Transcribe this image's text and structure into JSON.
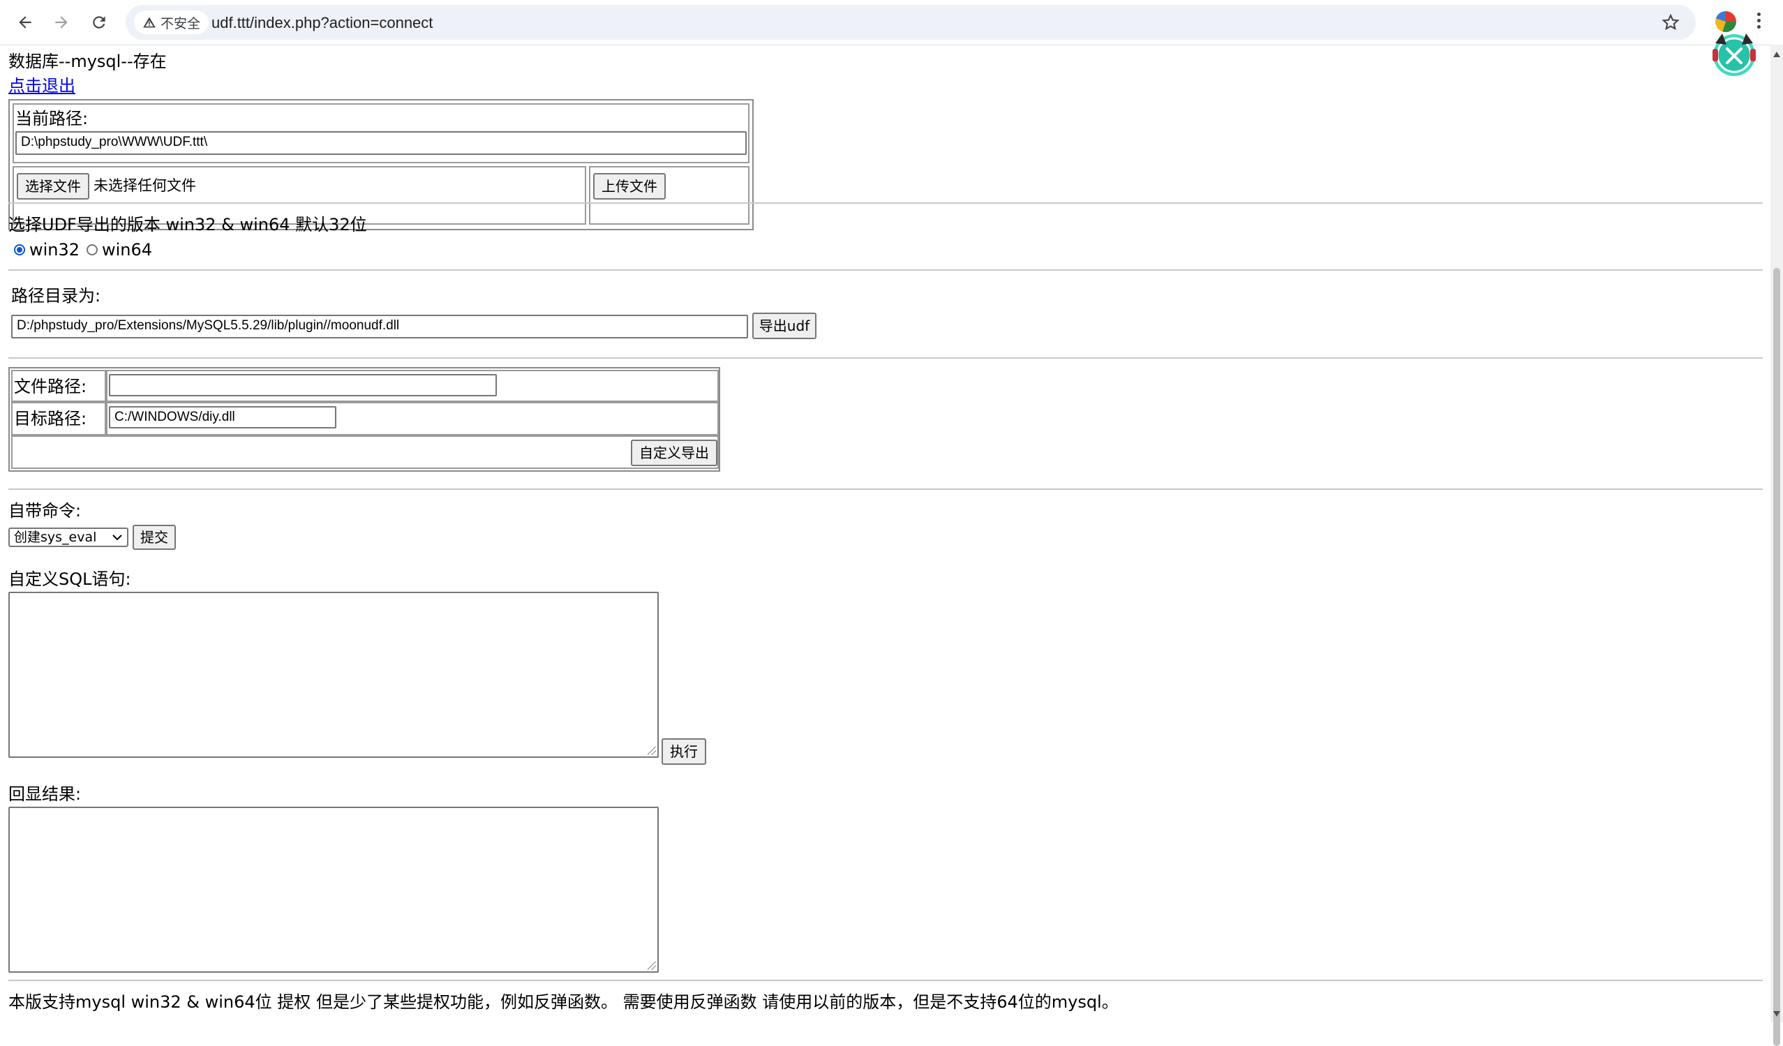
{
  "browser": {
    "security_label": "不安全",
    "url": "udf.ttt/index.php?action=connect"
  },
  "page": {
    "db_status": "数据库--mysql--存在",
    "logout_link": "点击退出",
    "upload": {
      "current_path_label": "当前路径:",
      "current_path_value": "D:\\phpstudy_pro\\WWW\\UDF.ttt\\",
      "choose_file_button": "选择文件",
      "no_file_text": "未选择任何文件",
      "upload_button": "上传文件"
    },
    "udf_version": {
      "prompt": "选择UDF导出的版本 win32 & win64 默认32位",
      "options": [
        {
          "label": "win32",
          "checked": true
        },
        {
          "label": "win64",
          "checked": false
        }
      ]
    },
    "export": {
      "dir_label": "路径目录为:",
      "dir_value": "D:/phpstudy_pro/Extensions/MySQL5.5.29/lib/plugin//moonudf.dll",
      "export_button": "导出udf"
    },
    "custom_export": {
      "file_path_label": "文件路径:",
      "file_path_value": "",
      "target_path_label": "目标路径:",
      "target_path_value": "C:/WINDOWS/diy.dll",
      "export_button": "自定义导出"
    },
    "builtin_cmd": {
      "label": "自带命令:",
      "selected": "创建sys_eval",
      "submit_button": "提交"
    },
    "custom_sql": {
      "label": "自定义SQL语句:",
      "value": "",
      "run_button": "执行"
    },
    "result": {
      "label": "回显结果:",
      "value": ""
    },
    "footer_note": "本版支持mysql win32 & win64位 提权 但是少了某些提权功能，例如反弹函数。 需要使用反弹函数 请使用以前的版本，但是不支持64位的mysql。"
  }
}
